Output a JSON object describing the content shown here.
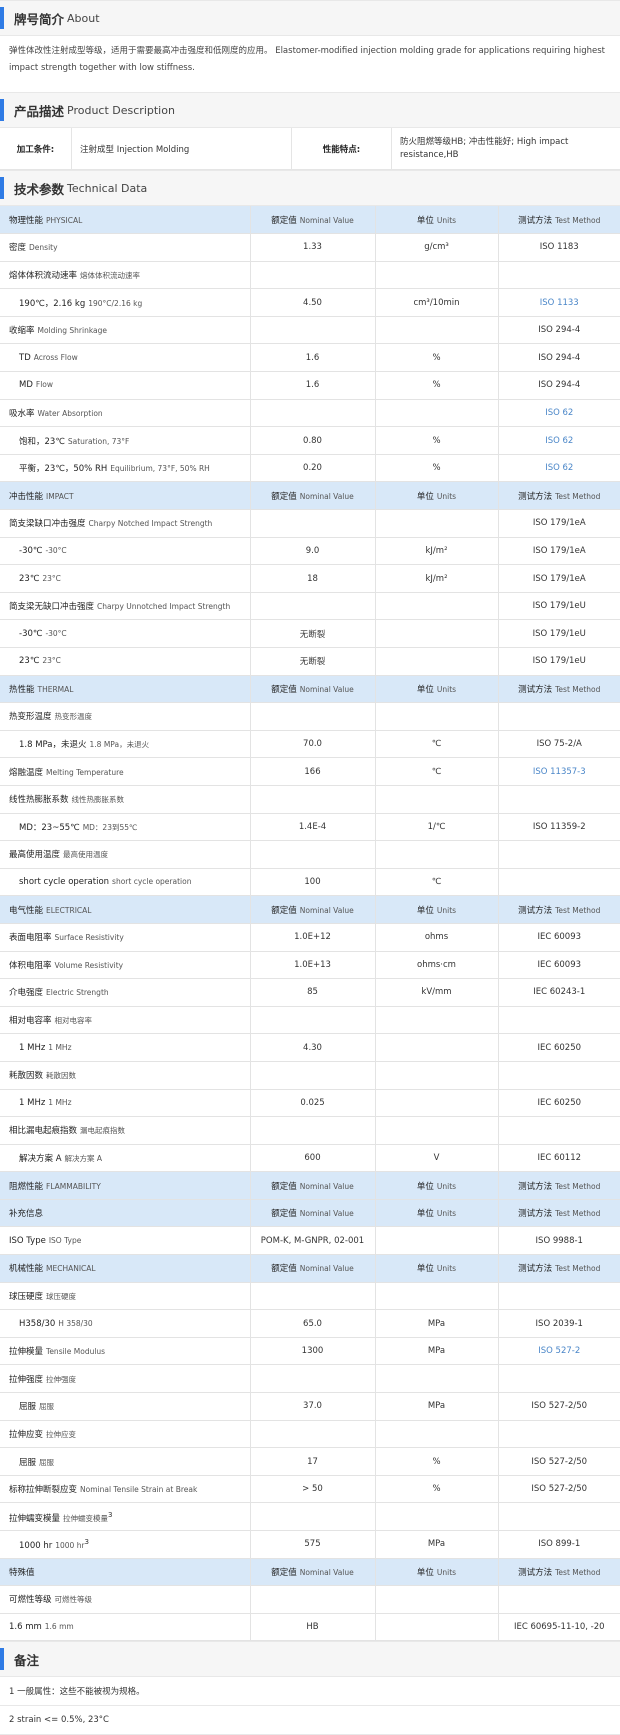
{
  "about": {
    "title_zh": "牌号简介",
    "title_en": "About",
    "text": "弹性体改性注射成型等级，适用于需要最高冲击强度和低刚度的应用。 Elastomer-modified injection molding grade for applications requiring highest impact strength together with low stiffness."
  },
  "description": {
    "title_zh": "产品描述",
    "title_en": "Product Description",
    "process_label": "加工条件:",
    "process_value": "注射成型 Injection Molding",
    "feature_label": "性能特点:",
    "feature_value": "防火阻燃等级HB; 冲击性能好; High impact resistance,HB"
  },
  "technical": {
    "title_zh": "技术参数",
    "title_en": "Technical Data",
    "header_labels": {
      "nominal_zh": "额定值",
      "nominal_en": "Nominal Value",
      "units_zh": "单位",
      "units_en": "Units",
      "method_zh": "测试方法",
      "method_en": "Test Method"
    },
    "rows": [
      {
        "type": "header",
        "zh": "物理性能",
        "en": "PHYSICAL"
      },
      {
        "zh": "密度",
        "en": "Density",
        "value": "1.33",
        "unit": "g/cm³",
        "method": "ISO 1183"
      },
      {
        "zh": "熔体体积流动速率",
        "en": "熔体体积流动速率",
        "value": "",
        "unit": "",
        "method": ""
      },
      {
        "indent": true,
        "zh": "190℃，2.16 kg",
        "en": "190°C/2.16 kg",
        "value": "4.50",
        "unit": "cm³/10min",
        "method": "ISO 1133",
        "link": true
      },
      {
        "zh": "收缩率",
        "en": "Molding Shrinkage",
        "value": "",
        "unit": "",
        "method": "ISO 294-4"
      },
      {
        "indent": true,
        "zh": "TD",
        "en": "Across Flow",
        "value": "1.6",
        "unit": "%",
        "method": "ISO 294-4"
      },
      {
        "indent": true,
        "zh": "MD",
        "en": "Flow",
        "value": "1.6",
        "unit": "%",
        "method": "ISO 294-4"
      },
      {
        "zh": "吸水率",
        "en": "Water Absorption",
        "value": "",
        "unit": "",
        "method": "ISO 62",
        "link": true
      },
      {
        "indent": true,
        "zh": "饱和，23℃",
        "en": "Saturation, 73°F",
        "value": "0.80",
        "unit": "%",
        "method": "ISO 62",
        "link": true
      },
      {
        "indent": true,
        "zh": "平衡，23℃，50% RH",
        "en": "Equilibrium, 73°F, 50% RH",
        "value": "0.20",
        "unit": "%",
        "method": "ISO 62",
        "link": true
      },
      {
        "type": "header",
        "zh": "冲击性能",
        "en": "IMPACT"
      },
      {
        "zh": "简支梁缺口冲击强度",
        "en": "Charpy Notched Impact Strength",
        "value": "",
        "unit": "",
        "method": "ISO 179/1eA"
      },
      {
        "indent": true,
        "zh": "-30℃",
        "en": "-30°C",
        "value": "9.0",
        "unit": "kJ/m²",
        "method": "ISO 179/1eA"
      },
      {
        "indent": true,
        "zh": "23℃",
        "en": "23°C",
        "value": "18",
        "unit": "kJ/m²",
        "method": "ISO 179/1eA"
      },
      {
        "zh": "简支梁无缺口冲击强度",
        "en": "Charpy Unnotched Impact Strength",
        "value": "",
        "unit": "",
        "method": "ISO 179/1eU"
      },
      {
        "indent": true,
        "zh": "-30℃",
        "en": "-30°C",
        "value": "无断裂",
        "unit": "",
        "method": "ISO 179/1eU"
      },
      {
        "indent": true,
        "zh": "23℃",
        "en": "23°C",
        "value": "无断裂",
        "unit": "",
        "method": "ISO 179/1eU"
      },
      {
        "type": "header",
        "zh": "热性能",
        "en": "THERMAL"
      },
      {
        "zh": "热变形温度",
        "en": "热变形温度",
        "value": "",
        "unit": "",
        "method": ""
      },
      {
        "indent": true,
        "zh": "1.8 MPa，未退火",
        "en": "1.8 MPa，未退火",
        "value": "70.0",
        "unit": "℃",
        "method": "ISO 75-2/A"
      },
      {
        "zh": "熔融温度",
        "en": "Melting Temperature",
        "value": "166",
        "unit": "℃",
        "method": "ISO 11357-3",
        "link": true
      },
      {
        "zh": "线性热膨胀系数",
        "en": "线性热膨胀系数",
        "value": "",
        "unit": "",
        "method": ""
      },
      {
        "indent": true,
        "zh": "MD：23~55℃",
        "en": "MD：23到55℃",
        "value": "1.4E-4",
        "unit": "1/℃",
        "method": "ISO 11359-2"
      },
      {
        "zh": "最高使用温度",
        "en": "最高使用温度",
        "value": "",
        "unit": "",
        "method": ""
      },
      {
        "indent": true,
        "zh": "short cycle operation",
        "en": "short cycle operation",
        "value": "100",
        "unit": "℃",
        "method": ""
      },
      {
        "type": "header",
        "zh": "电气性能",
        "en": "ELECTRICAL"
      },
      {
        "zh": "表面电阻率",
        "en": "Surface Resistivity",
        "value": "1.0E+12",
        "unit": "ohms",
        "method": "IEC 60093"
      },
      {
        "zh": "体积电阻率",
        "en": "Volume Resistivity",
        "value": "1.0E+13",
        "unit": "ohms·cm",
        "method": "IEC 60093"
      },
      {
        "zh": "介电强度",
        "en": "Electric Strength",
        "value": "85",
        "unit": "kV/mm",
        "method": "IEC 60243-1"
      },
      {
        "zh": "相对电容率",
        "en": "相对电容率",
        "value": "",
        "unit": "",
        "method": ""
      },
      {
        "indent": true,
        "zh": "1 MHz",
        "en": "1 MHz",
        "value": "4.30",
        "unit": "",
        "method": "IEC 60250"
      },
      {
        "zh": "耗散因数",
        "en": "耗散因数",
        "value": "",
        "unit": "",
        "method": ""
      },
      {
        "indent": true,
        "zh": "1 MHz",
        "en": "1 MHz",
        "value": "0.025",
        "unit": "",
        "method": "IEC 60250"
      },
      {
        "zh": "相比漏电起痕指数",
        "en": "漏电起痕指数",
        "value": "",
        "unit": "",
        "method": ""
      },
      {
        "indent": true,
        "zh": "解决方案 A",
        "en": "解决方案 A",
        "value": "600",
        "unit": "V",
        "method": "IEC 60112"
      },
      {
        "type": "header",
        "zh": "阻燃性能",
        "en": "FLAMMABILITY"
      },
      {
        "type": "header",
        "zh": "补充信息",
        "en": ""
      },
      {
        "zh": "ISO Type",
        "en": "ISO Type",
        "value": "POM-K, M-GNPR, 02-001",
        "unit": "",
        "method": "ISO 9988-1"
      },
      {
        "type": "header",
        "zh": "机械性能",
        "en": "MECHANICAL"
      },
      {
        "zh": "球压硬度",
        "en": "球压硬度",
        "value": "",
        "unit": "",
        "method": ""
      },
      {
        "indent": true,
        "zh": "H358/30",
        "en": "H 358/30",
        "value": "65.0",
        "unit": "MPa",
        "method": "ISO 2039-1"
      },
      {
        "zh": "拉伸模量",
        "en": "Tensile Modulus",
        "value": "1300",
        "unit": "MPa",
        "method": "ISO 527-2",
        "link": true
      },
      {
        "zh": "拉伸强度",
        "en": "拉伸强度",
        "value": "",
        "unit": "",
        "method": ""
      },
      {
        "indent": true,
        "zh": "屈服",
        "en": "屈服",
        "value": "37.0",
        "unit": "MPa",
        "method": "ISO 527-2/50"
      },
      {
        "zh": "拉伸应变",
        "en": "拉伸应变",
        "value": "",
        "unit": "",
        "method": ""
      },
      {
        "indent": true,
        "zh": "屈服",
        "en": "屈服",
        "value": "17",
        "unit": "%",
        "method": "ISO 527-2/50"
      },
      {
        "zh": "标称拉伸断裂应变",
        "en": "Nominal Tensile Strain at Break",
        "value": "> 50",
        "unit": "%",
        "method": "ISO 527-2/50"
      },
      {
        "zh": "拉伸蠕变模量",
        "en": "拉伸蠕变模量",
        "sup": "3",
        "value": "",
        "unit": "",
        "method": ""
      },
      {
        "indent": true,
        "zh": "1000 hr",
        "en": "1000 hr",
        "sup": "3",
        "value": "575",
        "unit": "MPa",
        "method": "ISO 899-1"
      },
      {
        "type": "header",
        "zh": "特殊值",
        "en": ""
      },
      {
        "zh": "可燃性等级",
        "en": "可燃性等级",
        "value": "",
        "unit": "",
        "method": ""
      },
      {
        "zh": "1.6 mm",
        "en": "1.6 mm",
        "value": "HB",
        "unit": "",
        "method": "IEC 60695-11-10, -20"
      }
    ]
  },
  "notes": {
    "title_zh": "备注",
    "items": [
      "1 一般属性：这些不能被视为规格。",
      "2 strain <= 0.5%, 23°C"
    ]
  },
  "colors": {
    "accent": "#2f7be5",
    "header_row": "#d8e8f8",
    "link": "#4a86c8"
  }
}
